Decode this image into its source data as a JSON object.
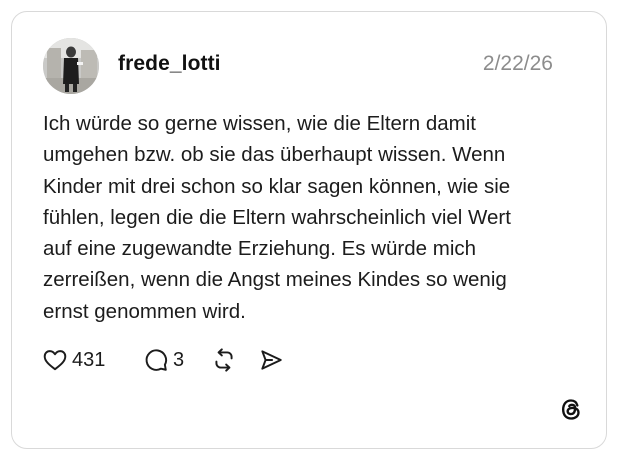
{
  "post": {
    "author": {
      "username": "frede_lotti",
      "avatar_icon": "avatar-photo"
    },
    "date": "2/22/26",
    "text": "Ich würde so gerne wissen, wie die Eltern damit\numgehen bzw. ob sie das überhaupt wissen. Wenn\nKinder mit drei schon so klar sagen können, wie sie\nfühlen, legen die die Eltern wahrscheinlich viel Wert\nauf eine zugewandte Erziehung. Es würde mich\nzerreißen, wenn die Angst meines Kindes so wenig\nernst genommen wird.",
    "stats": {
      "likes": "431",
      "replies": "3"
    }
  },
  "icons": {
    "like": "heart-icon",
    "reply": "comment-icon",
    "repost": "repost-icon",
    "share": "send-icon",
    "brand": "threads-logo-icon"
  },
  "colors": {
    "text": "#1c1c1c",
    "muted": "#8c8c8c",
    "border": "#d9d9d9"
  }
}
